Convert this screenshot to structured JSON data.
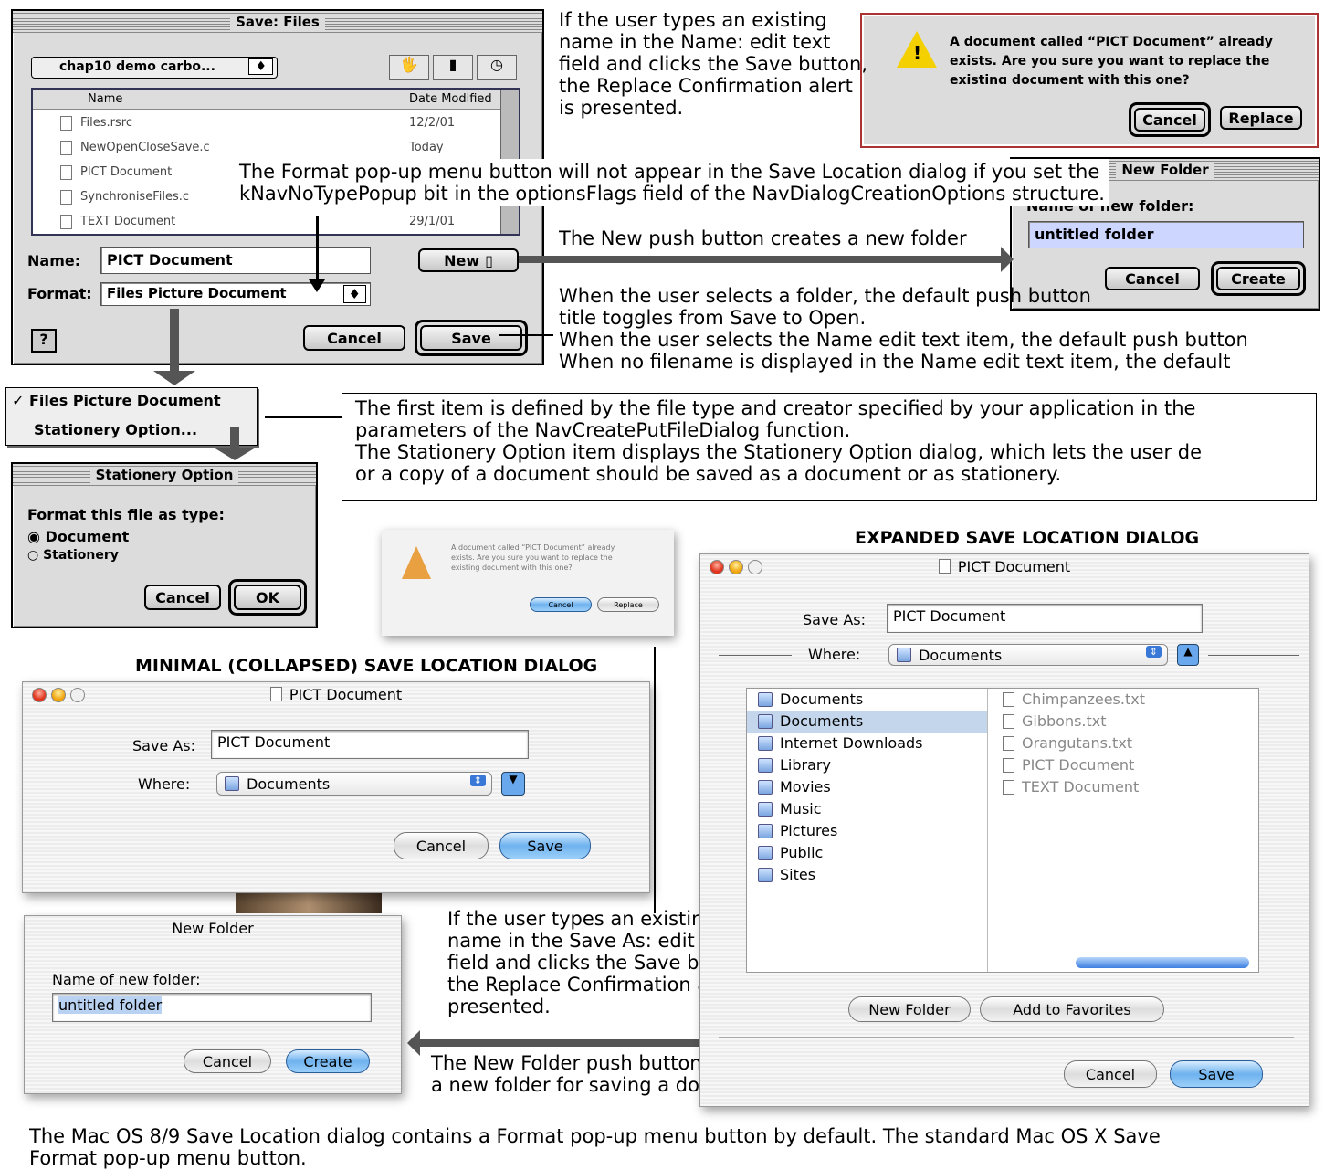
{
  "os9_save": {
    "title": "Save: Files",
    "location": "chap10 demo carbo...",
    "col_name": "Name",
    "col_date": "Date Modified",
    "files": [
      {
        "name": "Files.rsrc",
        "date": "12/2/01"
      },
      {
        "name": "NewOpenCloseSave.c",
        "date": "Today"
      },
      {
        "name": "PICT Document",
        "date": ""
      },
      {
        "name": "SynchroniseFiles.c",
        "date": ""
      },
      {
        "name": "TEXT Document",
        "date": "29/1/01"
      }
    ],
    "name_label": "Name:",
    "name_value": "PICT Document",
    "new_label": "New",
    "format_label": "Format:",
    "format_value": "Files Picture Document",
    "help": "?",
    "cancel": "Cancel",
    "save": "Save"
  },
  "format_menu": {
    "item1": "Files Picture Document",
    "item2": "Stationery Option...",
    "check": "✓"
  },
  "stationery": {
    "title": "Stationery Option",
    "prompt": "Format this file as type:",
    "opt1": "Document",
    "opt2": "Stationery",
    "cancel": "Cancel",
    "ok": "OK"
  },
  "os9_alert": {
    "message": "A document called “PICT Document” already exists. Are you sure you want to replace the existing document with this one?",
    "cancel": "Cancel",
    "replace": "Replace"
  },
  "os9_newfolder": {
    "title": "New Folder",
    "label": "Name of new folder:",
    "value": "untitled folder",
    "cancel": "Cancel",
    "create": "Create"
  },
  "notes": {
    "replace_os9": [
      "If the user types an existing",
      "name in the Name: edit text",
      "field and clicks the Save button,",
      "the Replace Confirmation alert",
      "is presented."
    ],
    "format_popup": [
      "The Format pop-up menu button will not appear in the Save Location dialog  if you set the",
      "kNavNoTypePopup bit in the optionsFlags field of the NavDialogCreationOptions structure."
    ],
    "new_button": "The New push button creates a new folder",
    "default_button": [
      "When the user selects a folder, the default push button",
      "title toggles from Save to Open.",
      "When the user selects the Name edit text item, the default push button",
      "When no filename is displayed in the Name edit text item, the default"
    ],
    "first_item": [
      "The first item is defined by the file type and creator specified by your application in the",
      "parameters of the NavCreatePutFileDialog function.",
      "The Stationery Option item displays the Stationery Option dialog, which lets the user de",
      "or a copy of a document should be saved as a document or as stationery."
    ],
    "replace_osx": [
      "If the user types an existing",
      "name in the Save As: edit text",
      "field and clicks the Save button,",
      "the Replace Confirmation alert is",
      "presented."
    ],
    "new_folder_osx": [
      "The New Folder push button enables the user to create",
      "a new folder for saving a document."
    ],
    "bottom": [
      "The Mac OS 8/9 Save Location dialog contains a Format pop-up menu button by default.  The standard Mac OS X Save",
      "Format pop-up menu button."
    ]
  },
  "headings": {
    "expanded": "EXPANDED SAVE LOCATION DIALOG",
    "minimal": "MINIMAL (COLLAPSED) SAVE LOCATION DIALOG"
  },
  "osx_alert": {
    "message": "A document called “PICT Document” already exists. Are you sure you want to replace the existing document with this one?",
    "cancel": "Cancel",
    "replace": "Replace"
  },
  "osx_expanded": {
    "title": "PICT Document",
    "save_as_label": "Save As:",
    "save_as_value": "PICT Document",
    "where_label": "Where:",
    "where_value": "Documents",
    "col1": [
      "Documents",
      "Documents",
      "Internet Downloads",
      "Library",
      "Movies",
      "Music",
      "Pictures",
      "Public",
      "Sites"
    ],
    "col2": [
      "Chimpanzees.txt",
      "Gibbons.txt",
      "Orangutans.txt",
      "PICT Document",
      "TEXT Document"
    ],
    "new_folder": "New Folder",
    "add_favorites": "Add to Favorites",
    "cancel": "Cancel",
    "save": "Save"
  },
  "osx_minimal": {
    "title": "PICT Document",
    "save_as_label": "Save As:",
    "save_as_value": "PICT Document",
    "where_label": "Where:",
    "where_value": "Documents",
    "cancel": "Cancel",
    "save": "Save"
  },
  "osx_newfolder": {
    "title": "New Folder",
    "label": "Name of new folder:",
    "value": "untitled folder",
    "cancel": "Cancel",
    "create": "Create"
  }
}
